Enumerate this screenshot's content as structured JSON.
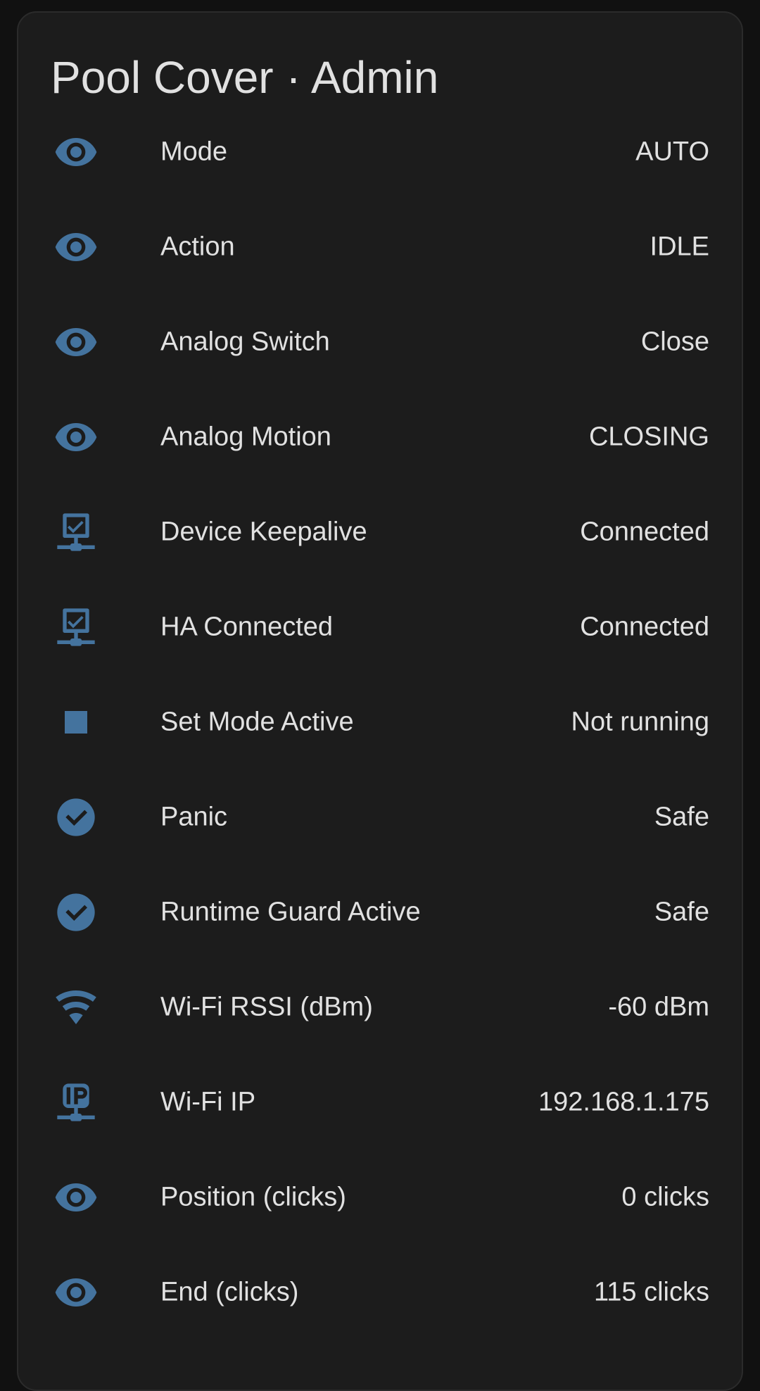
{
  "card": {
    "title": "Pool Cover · Admin"
  },
  "colors": {
    "icon": "#44739e",
    "background": "#1c1c1c",
    "text": "#e1e1e1"
  },
  "rows": [
    {
      "icon": "eye-icon",
      "label": "Mode",
      "value": "AUTO"
    },
    {
      "icon": "eye-icon",
      "label": "Action",
      "value": "IDLE"
    },
    {
      "icon": "eye-icon",
      "label": "Analog Switch",
      "value": "Close"
    },
    {
      "icon": "eye-icon",
      "label": "Analog Motion",
      "value": "CLOSING"
    },
    {
      "icon": "lan-connect-icon",
      "label": "Device Keepalive",
      "value": "Connected"
    },
    {
      "icon": "lan-connect-icon",
      "label": "HA Connected",
      "value": "Connected"
    },
    {
      "icon": "stop-icon",
      "label": "Set Mode Active",
      "value": "Not running"
    },
    {
      "icon": "check-circle-icon",
      "label": "Panic",
      "value": "Safe"
    },
    {
      "icon": "check-circle-icon",
      "label": "Runtime Guard Active",
      "value": "Safe"
    },
    {
      "icon": "wifi-icon",
      "label": "Wi-Fi RSSI (dBm)",
      "value": "-60 dBm"
    },
    {
      "icon": "ip-network-icon",
      "label": "Wi-Fi IP",
      "value": "192.168.1.175"
    },
    {
      "icon": "eye-icon",
      "label": "Position (clicks)",
      "value": "0 clicks"
    },
    {
      "icon": "eye-icon",
      "label": "End (clicks)",
      "value": "115 clicks"
    }
  ]
}
